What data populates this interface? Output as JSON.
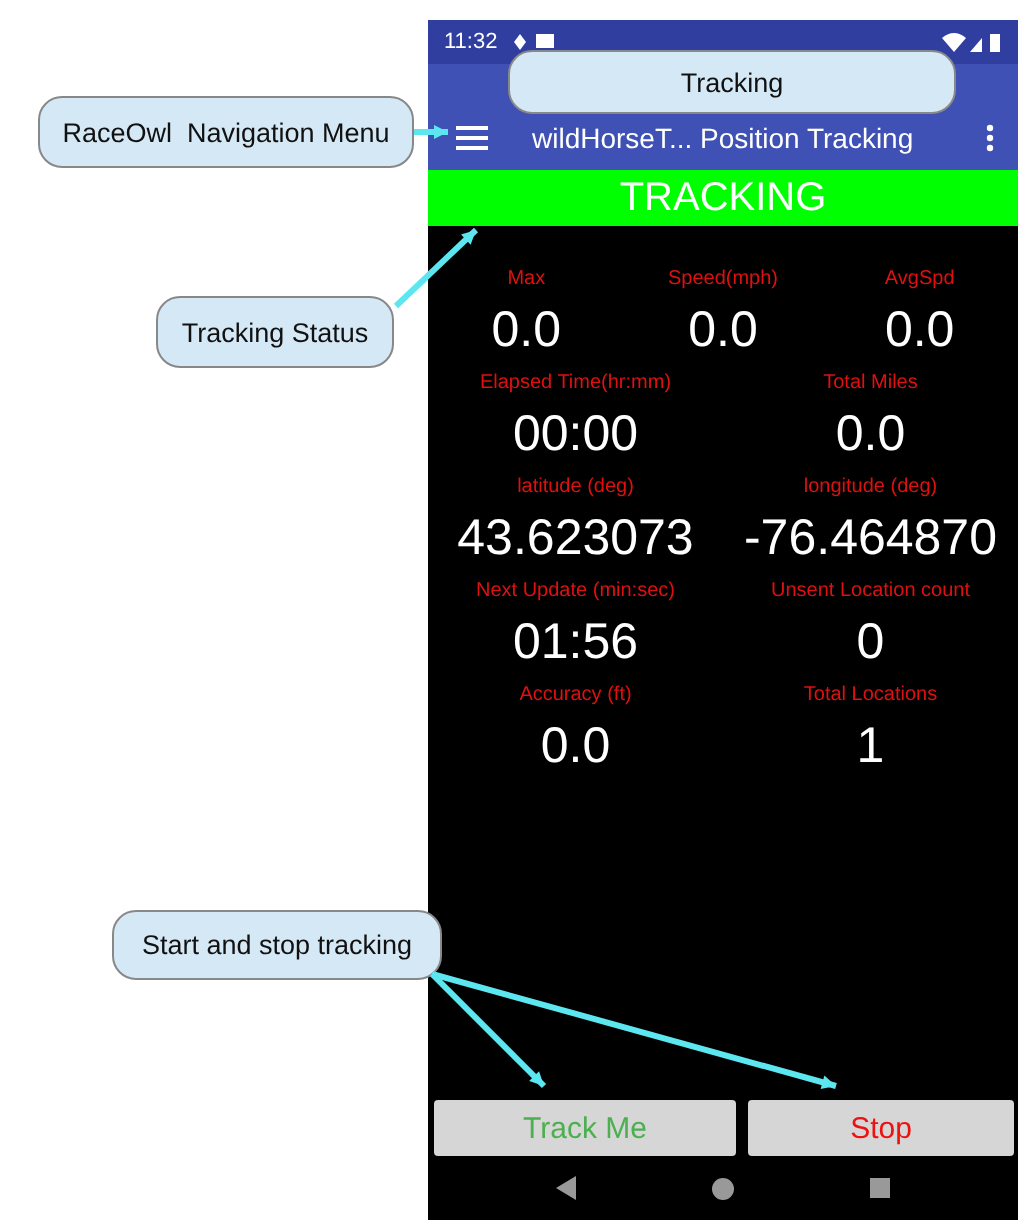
{
  "annotations": [
    {
      "text": "RaceOwl  Navigation Menu"
    },
    {
      "text": "Tracking"
    },
    {
      "text": "Tracking Status"
    },
    {
      "text": "Start and stop tracking"
    }
  ],
  "status_bar": {
    "time": "11:32"
  },
  "app_bar": {
    "title": "wildHorseT... Position Tracking"
  },
  "status_banner": "TRACKING",
  "stat_rows": [
    [
      {
        "label": "Max",
        "value": "0.0"
      },
      {
        "label": "Speed(mph)",
        "value": "0.0"
      },
      {
        "label": "AvgSpd",
        "value": "0.0"
      }
    ],
    [
      {
        "label": "Elapsed Time(hr:mm)",
        "value": "00:00"
      },
      {
        "label": "Total Miles",
        "value": "0.0"
      }
    ],
    [
      {
        "label": "latitude (deg)",
        "value": "43.623073"
      },
      {
        "label": "longitude (deg)",
        "value": "-76.464870"
      }
    ],
    [
      {
        "label": "Next Update (min:sec)",
        "value": "01:56"
      },
      {
        "label": "Unsent Location count",
        "value": "0"
      }
    ],
    [
      {
        "label": "Accuracy (ft)",
        "value": "0.0"
      },
      {
        "label": "Total Locations",
        "value": "1"
      }
    ]
  ],
  "buttons": [
    {
      "label": "Track Me",
      "kind": "start"
    },
    {
      "label": "Stop",
      "kind": "stop"
    }
  ]
}
